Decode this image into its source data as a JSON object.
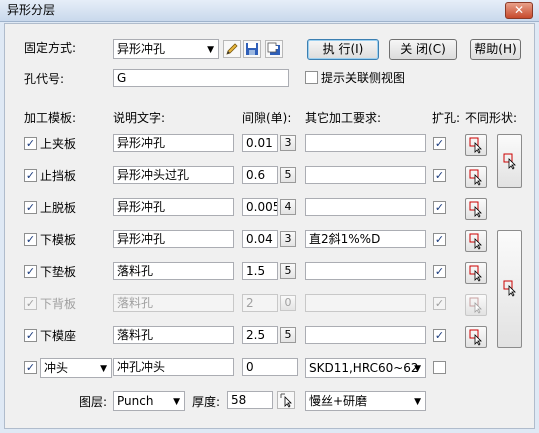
{
  "window": {
    "title": "异形分层",
    "close_glyph": "✕"
  },
  "fix_mode": {
    "label": "固定方式:",
    "value": "异形冲孔"
  },
  "toolbar": {
    "pencil_icon": "pencil-icon",
    "save_icon": "save-icon",
    "saveas_icon": "save-as-icon"
  },
  "buttons": {
    "execute": "执 行(I)",
    "close": "关 闭(C)",
    "help": "帮助(H)"
  },
  "hole_code": {
    "label": "孔代号:",
    "value": "G"
  },
  "show_side_view": {
    "label": "提示关联侧视图",
    "checked": false
  },
  "headers": {
    "plate": "加工模板:",
    "desc": "说明文字:",
    "gap": "间隙(单):",
    "other": "其它加工要求:",
    "expand": "扩孔:",
    "diff_shape": "不同形状:"
  },
  "rows": [
    {
      "plate": "上夹板",
      "checked": true,
      "enabled": true,
      "desc": "异形冲孔",
      "gap": "0.01",
      "spin": "3",
      "other": "",
      "expand": true
    },
    {
      "plate": "止挡板",
      "checked": true,
      "enabled": true,
      "desc": "异形冲头过孔",
      "gap": "0.6",
      "spin": "5",
      "other": "",
      "expand": true
    },
    {
      "plate": "上脱板",
      "checked": true,
      "enabled": true,
      "desc": "异形冲孔",
      "gap": "0.005",
      "spin": "4",
      "other": "",
      "expand": true
    },
    {
      "plate": "下模板",
      "checked": true,
      "enabled": true,
      "desc": "异形冲孔",
      "gap": "0.04",
      "spin": "3",
      "other": "直2斜1%%D",
      "expand": true
    },
    {
      "plate": "下垫板",
      "checked": true,
      "enabled": true,
      "desc": "落料孔",
      "gap": "1.5",
      "spin": "5",
      "other": "",
      "expand": true
    },
    {
      "plate": "下背板",
      "checked": true,
      "enabled": false,
      "desc": "落料孔",
      "gap": "2",
      "spin": "0",
      "other": "",
      "expand": true
    },
    {
      "plate": "下模座",
      "checked": true,
      "enabled": true,
      "desc": "落料孔",
      "gap": "2.5",
      "spin": "5",
      "other": "",
      "expand": true
    }
  ],
  "punch_row": {
    "checked": true,
    "type": "冲头",
    "desc": "冲孔冲头",
    "gap": "0",
    "other": "SKD11,HRC60~62",
    "expand": false
  },
  "layer": {
    "label": "图层:",
    "value": "Punch"
  },
  "thickness": {
    "label": "厚度:",
    "value": "58"
  },
  "finish": {
    "value": "慢丝+研磨"
  },
  "icons": {
    "pick_point": "pick-point-icon",
    "check": "✓",
    "arrow": "▼"
  }
}
